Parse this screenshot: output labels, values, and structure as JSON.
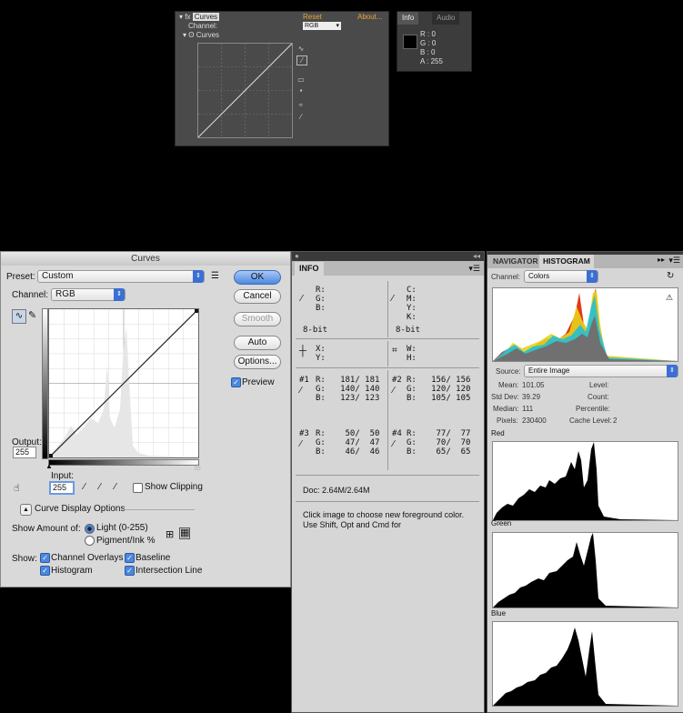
{
  "ae": {
    "effect": {
      "title": "Curves",
      "reset": "Reset",
      "about": "About...",
      "channel_label": "Channel:",
      "channel_value": "RGB",
      "sub_label": "Curves"
    },
    "info": {
      "tabs": [
        "Info",
        "Audio"
      ],
      "r": "R : 0",
      "g": "G : 0",
      "b": "B : 0",
      "a": "A : 255"
    }
  },
  "curves": {
    "title": "Curves",
    "preset_label": "Preset:",
    "preset_value": "Custom",
    "channel_label": "Channel:",
    "channel_value": "RGB",
    "buttons": {
      "ok": "OK",
      "cancel": "Cancel",
      "smooth": "Smooth",
      "auto": "Auto",
      "options": "Options..."
    },
    "preview_label": "Preview",
    "output_label": "Output:",
    "output_value": "255",
    "input_label": "Input:",
    "input_value": "255",
    "show_clipping": "Show Clipping",
    "display_options": "Curve Display Options",
    "show_amount_label": "Show Amount of:",
    "light_label": "Light  (0-255)",
    "pigment_label": "Pigment/Ink %",
    "show_label": "Show:",
    "channel_overlays": "Channel Overlays",
    "baseline": "Baseline",
    "histogram": "Histogram",
    "intersection_line": "Intersection Line"
  },
  "info": {
    "tab": "INFO",
    "rgb_block": "R:\nG:\nB:",
    "cmyk_block": "C:\nM:\nY:\nK:",
    "bit_left": "8-bit",
    "bit_right": "8-bit",
    "xy_block": "X:\nY:",
    "wh_block": "W:\nH:",
    "s1_label": "#1",
    "s1_values": "R:   181/ 181\nG:   140/ 140\nB:   123/ 123",
    "s2_label": "#2",
    "s2_values": "R:   156/ 156\nG:   120/ 120\nB:   105/ 105",
    "s3_label": "#3",
    "s3_values": "R:    50/  50\nG:    47/  47\nB:    46/  46",
    "s4_label": "#4",
    "s4_values": "R:    77/  77\nG:    70/  70\nB:    65/  65",
    "doc": "Doc: 2.64M/2.64M",
    "hint": "Click image to choose new foreground color.  Use Shift, Opt and Cmd for"
  },
  "histogram": {
    "tabs": [
      "NAVIGATOR",
      "HISTOGRAM"
    ],
    "channel_label": "Channel:",
    "channel_value": "Colors",
    "source_label": "Source:",
    "source_value": "Entire Image",
    "stats": {
      "mean_label": "Mean:",
      "mean": "101.05",
      "std_label": "Std Dev:",
      "std": "39.29",
      "median_label": "Median:",
      "median": "111",
      "pixels_label": "Pixels:",
      "pixels": "230400",
      "level_label": "Level:",
      "count_label": "Count:",
      "percentile_label": "Percentile:",
      "cache_label": "Cache Level:",
      "cache": "2"
    },
    "red_label": "Red",
    "green_label": "Green",
    "blue_label": "Blue"
  }
}
